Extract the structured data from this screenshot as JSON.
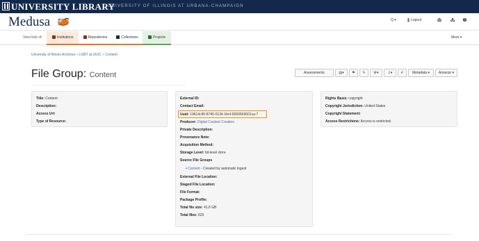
{
  "banner": {
    "title": "UNIVERSITY LIBRARY",
    "subtitle": "UNIVERSITY OF ILLINOIS AT URBANA-CHAMPAIGN"
  },
  "header": {
    "brand": "Medusa",
    "search_label": "Q ▾",
    "logout_label": "Logout",
    "icons": [
      "search-icon",
      "user-icon",
      "bank-icon",
      "sitemap-icon",
      "help-icon"
    ]
  },
  "tabs": {
    "label": "View lists of:",
    "items": [
      {
        "label": "Institutions",
        "icon": "bank-icon"
      },
      {
        "label": "Repositories",
        "icon": "book-icon"
      },
      {
        "label": "Collections",
        "icon": "collection-icon"
      },
      {
        "label": "Projects",
        "icon": "projects-icon"
      }
    ],
    "more": "More ▾"
  },
  "breadcrumb": [
    "University of Illinois Archives",
    "LGBT at UIUC",
    "Content"
  ],
  "page": {
    "title_prefix": "File Group:",
    "title_name": "Content"
  },
  "toolbar": {
    "assessments": "Assessments",
    "metadata": "Metadata ▾",
    "amazon": "Amazon ▾"
  },
  "left_panel": {
    "title_label": "Title:",
    "title_value": "Content",
    "description_label": "Description:",
    "access_url_label": "Access Url:",
    "resource_type_label": "Type of Resource:"
  },
  "middle_panel": {
    "external_id_label": "External ID:",
    "contact_email_label": "Contact Email:",
    "uuid_label": "Uuid:",
    "uuid_value": "19614c90-8745-0134-1fe4-0050569601ca-7",
    "producer_label": "Producer:",
    "producer_value": "Digital Content Creation",
    "private_description_label": "Private Description:",
    "provenance_note_label": "Provenance Note:",
    "acquisition_method_label": "Acquisition Method:",
    "storage_level_label": "Storage Level:",
    "storage_level_value": "bit-level store",
    "source_file_groups_label": "Source File Groups",
    "source_link": "Content",
    "source_note": "- Created by automatic ingest",
    "external_file_location_label": "External File Location:",
    "staged_file_location_label": "Staged File Location:",
    "file_format_label": "File Format:",
    "package_profile_label": "Package Profile:",
    "total_file_size_label": "Total file size:",
    "total_file_size_value": "41.6 GB",
    "total_files_label": "Total files:",
    "total_files_value": "625"
  },
  "right_panel": {
    "rights_basis_label": "Rights Basis:",
    "rights_basis_value": "copyright",
    "copyright_jurisdiction_label": "Copyright Jurisdiction:",
    "copyright_jurisdiction_value": "United States",
    "copyright_statement_label": "Copyright Statement:",
    "access_restrictions_label": "Access Restrictions:",
    "access_restrictions_value": "Access is restricted."
  },
  "colors": {
    "banner": "#13294b",
    "accent_orange": "#e8711f",
    "highlight": "#f28c00",
    "link": "#3b6ea5"
  }
}
